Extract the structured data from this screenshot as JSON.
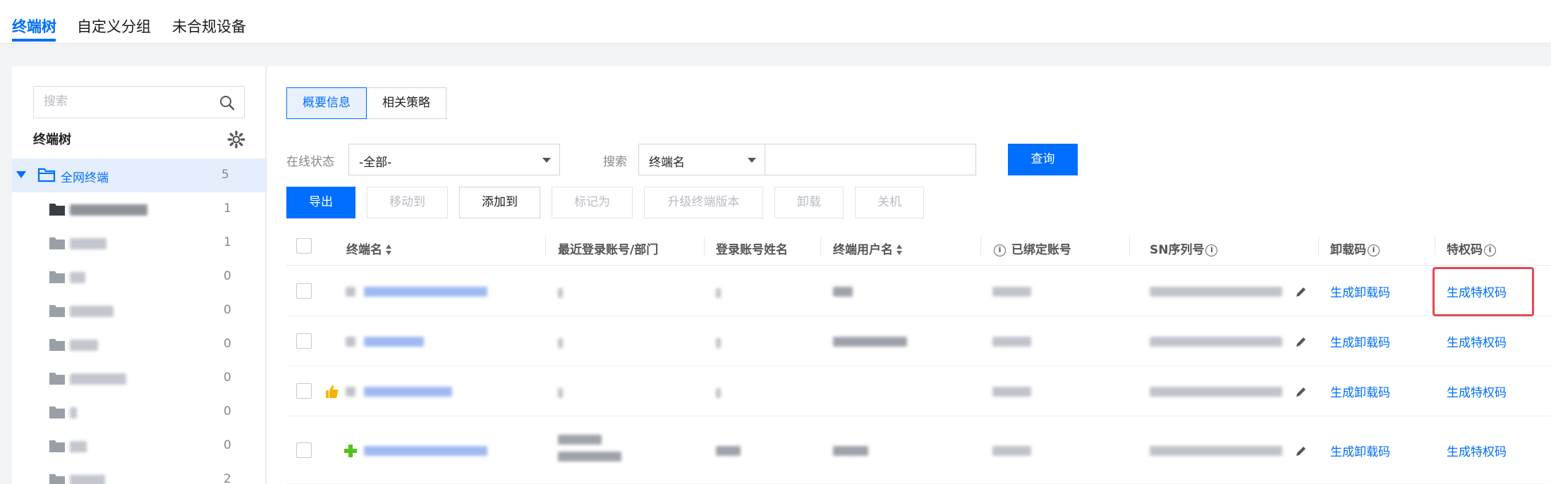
{
  "topnav": {
    "tabs": [
      {
        "label": "终端树",
        "active": true
      },
      {
        "label": "自定义分组",
        "active": false
      },
      {
        "label": "未合规设备",
        "active": false
      }
    ]
  },
  "sidebar": {
    "search_placeholder": "搜索",
    "tree_title": "终端树",
    "root": {
      "label": "全网终端",
      "count": "5"
    },
    "groups": [
      {
        "count": "1"
      },
      {
        "count": "1"
      },
      {
        "count": "0"
      },
      {
        "count": "0"
      },
      {
        "count": "0"
      },
      {
        "count": "0"
      },
      {
        "count": "0"
      },
      {
        "count": "0"
      },
      {
        "count": "2"
      }
    ]
  },
  "main": {
    "subtabs": [
      {
        "label": "概要信息",
        "active": true
      },
      {
        "label": "相关策略",
        "active": false
      }
    ],
    "filters": {
      "status_label": "在线状态",
      "status_value": "-全部-",
      "search_label": "搜索",
      "search_field": "终端名",
      "search_value": "",
      "query_button": "查询"
    },
    "actions": {
      "export": "导出",
      "move_to": "移动到",
      "add_to": "添加到",
      "mark_as": "标记为",
      "upgrade": "升级终端版本",
      "uninstall": "卸载",
      "shutdown": "关机"
    },
    "table": {
      "headers": {
        "name": "终端名",
        "last_login": "最近登录账号/部门",
        "login_name": "登录账号姓名",
        "terminal_user": "终端用户名",
        "bound_account": "已绑定账号",
        "sn": "SN序列号",
        "uninstall_code": "卸载码",
        "privilege_code": "特权码"
      },
      "rows": [
        {
          "uninstall_link": "生成卸载码",
          "privilege_link": "生成特权码",
          "highlighted": true
        },
        {
          "uninstall_link": "生成卸载码",
          "privilege_link": "生成特权码",
          "highlighted": false
        },
        {
          "uninstall_link": "生成卸载码",
          "privilege_link": "生成特权码",
          "highlighted": false
        },
        {
          "uninstall_link": "生成卸载码",
          "privilege_link": "生成特权码",
          "highlighted": false
        }
      ]
    }
  },
  "colors": {
    "accent": "#006eff",
    "highlight": "#e5484d",
    "selected_bg": "#e5eefc"
  }
}
